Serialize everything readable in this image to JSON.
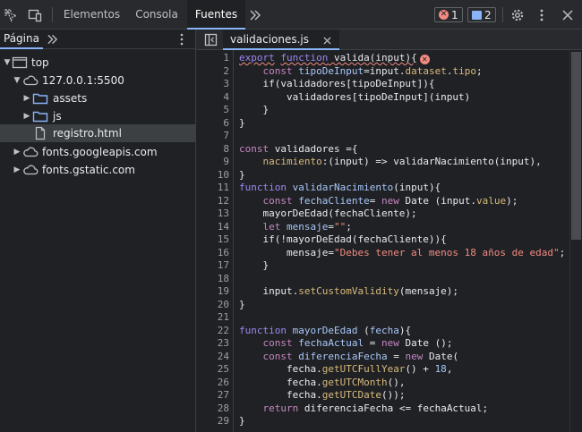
{
  "toolbar": {
    "tabs": [
      {
        "label": "Elementos"
      },
      {
        "label": "Consola"
      },
      {
        "label": "Fuentes"
      }
    ],
    "active_tab": "Fuentes",
    "errors_count": "1",
    "messages_count": "2",
    "colors": {
      "error": "#f28b82",
      "message": "#8ab4f8",
      "accent": "#8ab4f8"
    }
  },
  "navigator": {
    "tab_label": "Página",
    "tree": [
      {
        "label": "top",
        "icon": "frame-icon",
        "expanded": true
      },
      {
        "label": "127.0.0.1:5500",
        "icon": "cloud-icon",
        "expanded": true
      },
      {
        "label": "assets",
        "icon": "folder-icon",
        "expanded": false
      },
      {
        "label": "js",
        "icon": "folder-icon",
        "expanded": false
      },
      {
        "label": "registro.html",
        "icon": "file-icon",
        "selected": true
      },
      {
        "label": "fonts.googleapis.com",
        "icon": "cloud-icon",
        "expanded": false
      },
      {
        "label": "fonts.gstatic.com",
        "icon": "cloud-icon",
        "expanded": false
      }
    ]
  },
  "editor": {
    "file_tab": "validaciones.js",
    "lines": [
      "1",
      "2",
      "3",
      "4",
      "5",
      "6",
      "7",
      "8",
      "9",
      "10",
      "11",
      "12",
      "13",
      "14",
      "15",
      "16",
      "17",
      "18",
      "19",
      "20",
      "21",
      "22",
      "23",
      "24",
      "25",
      "26",
      "27",
      "28",
      "29"
    ],
    "code": {
      "l1": [
        "export",
        " ",
        "function",
        " valida(input){"
      ],
      "l2": [
        "    ",
        "const",
        " tipoDeInput",
        "=input.",
        "dataset",
        ".",
        "tipo",
        ";"
      ],
      "l3": [
        "    if(validadores[tipoDeInput]){"
      ],
      "l4": [
        "        validadores[tipoDeInput](input)"
      ],
      "l5": [
        "    }"
      ],
      "l6": [
        "}"
      ],
      "l7": [
        ""
      ],
      "l8": [
        "const",
        " validadores ={"
      ],
      "l9": [
        "    ",
        "nacimiento",
        ":(input) => validarNacimiento(input),"
      ],
      "l10": [
        "}"
      ],
      "l11": [
        "function",
        " ",
        "validarNacimiento",
        "(input){"
      ],
      "l12": [
        "    ",
        "const",
        " ",
        "fechaCliente",
        "= ",
        "new",
        " Date (input.",
        "value",
        ");"
      ],
      "l13": [
        "    mayorDeEdad(fechaCliente);"
      ],
      "l14": [
        "    ",
        "let",
        " ",
        "mensaje",
        "=",
        "\"\"",
        ";"
      ],
      "l15": [
        "    if(!mayorDeEdad(fechaCliente)){"
      ],
      "l16": [
        "        mensaje=",
        "\"Debes tener al menos 18 años de edad\"",
        ";"
      ],
      "l17": [
        "    }"
      ],
      "l18": [
        ""
      ],
      "l19": [
        "    input.",
        "setCustomValidity",
        "(mensaje);"
      ],
      "l20": [
        "}"
      ],
      "l21": [
        ""
      ],
      "l22": [
        "function",
        " ",
        "mayorDeEdad",
        " (",
        "fecha",
        "){"
      ],
      "l23": [
        "    ",
        "const",
        " ",
        "fechaActual",
        " = ",
        "new",
        " Date ();"
      ],
      "l24": [
        "    ",
        "const",
        " ",
        "diferenciaFecha",
        " = ",
        "new",
        " Date("
      ],
      "l25": [
        "        fecha.",
        "getUTCFullYear",
        "() + ",
        "18",
        ","
      ],
      "l26": [
        "        fecha.",
        "getUTCMonth",
        "(),"
      ],
      "l27": [
        "        fecha.",
        "getUTCDate",
        "());"
      ],
      "l28": [
        "    ",
        "return",
        " diferenciaFecha <= fechaActual;"
      ],
      "l29": [
        "}"
      ]
    }
  }
}
